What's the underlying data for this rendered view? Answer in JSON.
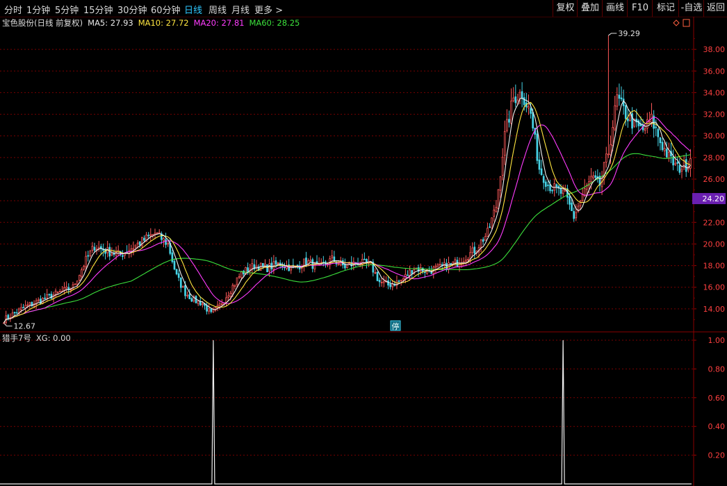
{
  "toolbar": {
    "periods": [
      "分时",
      "1分钟",
      "5分钟",
      "15分钟",
      "30分钟",
      "60分钟",
      "日线",
      "周线",
      "月线",
      "更多 >"
    ],
    "active_period": "日线",
    "buttons": [
      "复权",
      "叠加",
      "画线",
      "F10",
      "标记",
      "-自选",
      "返回"
    ]
  },
  "main_panel": {
    "legend": {
      "title": "宝色股份(日线 前复权)",
      "ma5": "MA5: 27.93",
      "ma10": "MA10: 27.72",
      "ma20": "MA20: 27.81",
      "ma60": "MA60: 28.25"
    },
    "high_marker": "39.29",
    "low_marker": "12.67",
    "current_price_tag": "24.20",
    "suspend_marker": "停"
  },
  "indicator_panel": {
    "title": "猎手7号",
    "value_label": "XG: 0.00"
  },
  "colors": {
    "up": "#ff5a5a",
    "down": "#46d3e6",
    "ma5": "#f0f0f0",
    "ma10": "#ffe640",
    "ma20": "#ff3cff",
    "ma60": "#3ce03c",
    "grid": "#7a0000",
    "axis_text": "#ff4040",
    "tag_bg": "#6a1fb0"
  },
  "chart_data": [
    {
      "type": "candlestick",
      "ylim": [
        12.0,
        40.0
      ],
      "yticks": [
        14.0,
        16.0,
        18.0,
        20.0,
        22.0,
        24.0,
        26.0,
        28.0,
        30.0,
        32.0,
        34.0,
        36.0,
        38.0
      ],
      "close_anchors": [
        [
          0,
          13.0
        ],
        [
          10,
          14.2
        ],
        [
          22,
          15.2
        ],
        [
          32,
          16.0
        ],
        [
          38,
          18.5
        ],
        [
          42,
          19.8
        ],
        [
          48,
          19.3
        ],
        [
          54,
          19.0
        ],
        [
          62,
          20.0
        ],
        [
          70,
          21.0
        ],
        [
          76,
          20.0
        ],
        [
          80,
          17.0
        ],
        [
          84,
          15.5
        ],
        [
          88,
          14.8
        ],
        [
          92,
          14.5
        ],
        [
          96,
          13.5
        ],
        [
          100,
          14.3
        ],
        [
          104,
          15.5
        ],
        [
          110,
          17.3
        ],
        [
          116,
          18.0
        ],
        [
          122,
          17.8
        ],
        [
          128,
          18.2
        ],
        [
          134,
          17.7
        ],
        [
          140,
          18.4
        ],
        [
          146,
          17.8
        ],
        [
          152,
          18.6
        ],
        [
          158,
          17.9
        ],
        [
          164,
          18.3
        ],
        [
          170,
          18.0
        ],
        [
          174,
          16.5
        ],
        [
          178,
          16.2
        ],
        [
          184,
          16.6
        ],
        [
          190,
          17.8
        ],
        [
          196,
          17.5
        ],
        [
          202,
          17.8
        ],
        [
          210,
          18.3
        ],
        [
          218,
          19.4
        ],
        [
          224,
          21.0
        ],
        [
          228,
          23.5
        ],
        [
          232,
          30.0
        ],
        [
          236,
          33.5
        ],
        [
          240,
          34.0
        ],
        [
          244,
          32.0
        ],
        [
          248,
          27.0
        ],
        [
          252,
          25.5
        ],
        [
          256,
          25.0
        ],
        [
          260,
          24.5
        ],
        [
          264,
          22.5
        ],
        [
          268,
          24.5
        ],
        [
          272,
          26.0
        ],
        [
          276,
          25.5
        ],
        [
          280,
          28.5
        ],
        [
          284,
          33.5
        ],
        [
          288,
          32.0
        ],
        [
          292,
          31.0
        ],
        [
          296,
          30.5
        ],
        [
          300,
          31.5
        ],
        [
          304,
          29.5
        ],
        [
          308,
          28.0
        ],
        [
          312,
          27.0
        ],
        [
          316,
          27.3
        ],
        [
          318,
          27.9
        ]
      ],
      "ma5": 27.93,
      "ma10": 27.72,
      "ma20": 27.81,
      "ma60": 28.25
    },
    {
      "type": "line",
      "series": [
        {
          "name": "XG",
          "signal_bars": [
            97,
            259
          ]
        }
      ],
      "ylim": [
        0.0,
        1.0
      ],
      "yticks": [
        0.2,
        0.4,
        0.6,
        0.8,
        1.0
      ]
    }
  ]
}
